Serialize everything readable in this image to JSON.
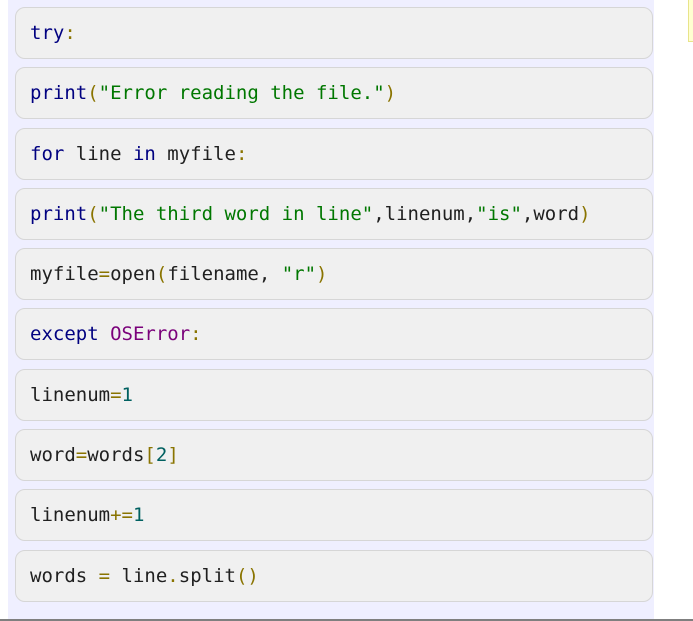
{
  "colors": {
    "keyword": "#000080",
    "builtin": "#000080",
    "string": "#007700",
    "number": "#006060",
    "operator": "#8a7400",
    "exception": "#7a007a",
    "name": "#202020"
  },
  "blocks": [
    {
      "tokens": [
        {
          "t": "try",
          "k": "keyword"
        },
        {
          "t": ":",
          "k": "operator"
        }
      ]
    },
    {
      "tokens": [
        {
          "t": "print",
          "k": "builtin"
        },
        {
          "t": "(",
          "k": "operator"
        },
        {
          "t": "\"Error reading the file.\"",
          "k": "string"
        },
        {
          "t": ")",
          "k": "operator"
        }
      ]
    },
    {
      "tokens": [
        {
          "t": "for",
          "k": "keyword"
        },
        {
          "t": " line ",
          "k": "name"
        },
        {
          "t": "in",
          "k": "keyword"
        },
        {
          "t": " myfile",
          "k": "name"
        },
        {
          "t": ":",
          "k": "operator"
        }
      ]
    },
    {
      "tokens": [
        {
          "t": "print",
          "k": "builtin"
        },
        {
          "t": "(",
          "k": "operator"
        },
        {
          "t": "\"The third word in line\"",
          "k": "string"
        },
        {
          "t": ",linenum,",
          "k": "name"
        },
        {
          "t": "\"is\"",
          "k": "string"
        },
        {
          "t": ",word",
          "k": "name"
        },
        {
          "t": ")",
          "k": "operator"
        }
      ]
    },
    {
      "tokens": [
        {
          "t": "myfile",
          "k": "name"
        },
        {
          "t": "=",
          "k": "operator"
        },
        {
          "t": "open",
          "k": "name"
        },
        {
          "t": "(",
          "k": "operator"
        },
        {
          "t": "filename, ",
          "k": "name"
        },
        {
          "t": "\"r\"",
          "k": "string"
        },
        {
          "t": ")",
          "k": "operator"
        }
      ]
    },
    {
      "tokens": [
        {
          "t": "except",
          "k": "keyword"
        },
        {
          "t": " ",
          "k": "name"
        },
        {
          "t": "OSError",
          "k": "exception"
        },
        {
          "t": ":",
          "k": "operator"
        }
      ]
    },
    {
      "tokens": [
        {
          "t": "linenum",
          "k": "name"
        },
        {
          "t": "=",
          "k": "operator"
        },
        {
          "t": "1",
          "k": "number"
        }
      ]
    },
    {
      "tokens": [
        {
          "t": "word",
          "k": "name"
        },
        {
          "t": "=",
          "k": "operator"
        },
        {
          "t": "words",
          "k": "name"
        },
        {
          "t": "[",
          "k": "operator"
        },
        {
          "t": "2",
          "k": "number"
        },
        {
          "t": "]",
          "k": "operator"
        }
      ]
    },
    {
      "tokens": [
        {
          "t": "linenum",
          "k": "name"
        },
        {
          "t": "+=",
          "k": "operator"
        },
        {
          "t": "1",
          "k": "number"
        }
      ]
    },
    {
      "tokens": [
        {
          "t": "words ",
          "k": "name"
        },
        {
          "t": "=",
          "k": "operator"
        },
        {
          "t": " line",
          "k": "name"
        },
        {
          "t": ".",
          "k": "operator"
        },
        {
          "t": "split",
          "k": "name"
        },
        {
          "t": "()",
          "k": "operator"
        }
      ]
    }
  ]
}
